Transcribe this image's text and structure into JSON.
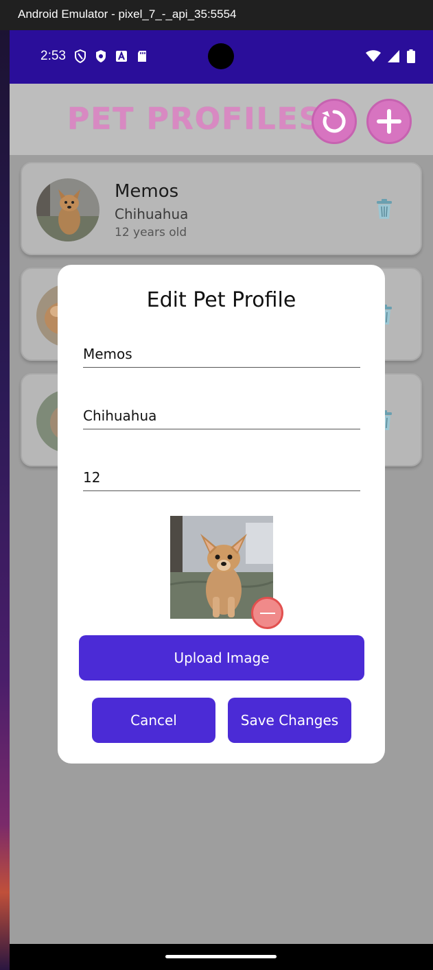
{
  "window": {
    "title": "Android Emulator - pixel_7_-_api_35:5554"
  },
  "statusbar": {
    "time": "2:53",
    "left_icons": [
      "shield-outline-icon",
      "shield-filled-icon",
      "text-a-icon",
      "sd-card-icon"
    ],
    "right_icons": [
      "wifi-icon",
      "signal-icon",
      "battery-icon"
    ]
  },
  "appbar": {
    "title": "PET PROFILES",
    "refresh_icon": "refresh-icon",
    "add_icon": "plus-icon"
  },
  "pets": [
    {
      "name": "Memos",
      "breed": "Chihuahua",
      "age": "12 years old"
    },
    {
      "name": "",
      "breed": "",
      "age": ""
    },
    {
      "name": "",
      "breed": "",
      "age": ""
    }
  ],
  "dialog": {
    "title": "Edit Pet Profile",
    "name_value": "Memos",
    "breed_value": "Chihuahua",
    "age_value": "12",
    "upload_label": "Upload Image",
    "cancel_label": "Cancel",
    "save_label": "Save Changes"
  },
  "colors": {
    "statusbar": "#2a0e9a",
    "primary_button": "#4b2bd6",
    "title_pink": "#d889c2",
    "remove_red": "#e2504f"
  }
}
